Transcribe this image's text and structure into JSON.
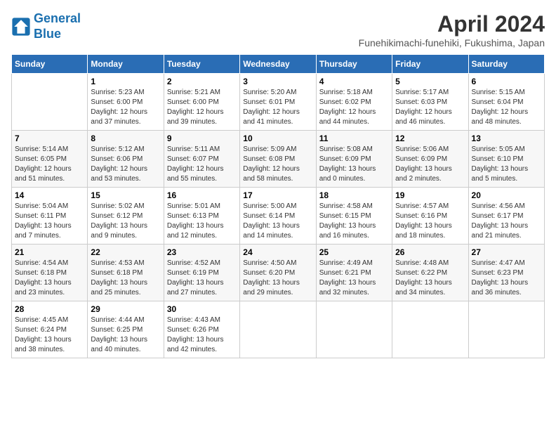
{
  "header": {
    "logo_line1": "General",
    "logo_line2": "Blue",
    "title": "April 2024",
    "subtitle": "Funehikimachi-funehiki, Fukushima, Japan"
  },
  "weekdays": [
    "Sunday",
    "Monday",
    "Tuesday",
    "Wednesday",
    "Thursday",
    "Friday",
    "Saturday"
  ],
  "weeks": [
    [
      {
        "day": "",
        "info": ""
      },
      {
        "day": "1",
        "info": "Sunrise: 5:23 AM\nSunset: 6:00 PM\nDaylight: 12 hours\nand 37 minutes."
      },
      {
        "day": "2",
        "info": "Sunrise: 5:21 AM\nSunset: 6:00 PM\nDaylight: 12 hours\nand 39 minutes."
      },
      {
        "day": "3",
        "info": "Sunrise: 5:20 AM\nSunset: 6:01 PM\nDaylight: 12 hours\nand 41 minutes."
      },
      {
        "day": "4",
        "info": "Sunrise: 5:18 AM\nSunset: 6:02 PM\nDaylight: 12 hours\nand 44 minutes."
      },
      {
        "day": "5",
        "info": "Sunrise: 5:17 AM\nSunset: 6:03 PM\nDaylight: 12 hours\nand 46 minutes."
      },
      {
        "day": "6",
        "info": "Sunrise: 5:15 AM\nSunset: 6:04 PM\nDaylight: 12 hours\nand 48 minutes."
      }
    ],
    [
      {
        "day": "7",
        "info": "Sunrise: 5:14 AM\nSunset: 6:05 PM\nDaylight: 12 hours\nand 51 minutes."
      },
      {
        "day": "8",
        "info": "Sunrise: 5:12 AM\nSunset: 6:06 PM\nDaylight: 12 hours\nand 53 minutes."
      },
      {
        "day": "9",
        "info": "Sunrise: 5:11 AM\nSunset: 6:07 PM\nDaylight: 12 hours\nand 55 minutes."
      },
      {
        "day": "10",
        "info": "Sunrise: 5:09 AM\nSunset: 6:08 PM\nDaylight: 12 hours\nand 58 minutes."
      },
      {
        "day": "11",
        "info": "Sunrise: 5:08 AM\nSunset: 6:09 PM\nDaylight: 13 hours\nand 0 minutes."
      },
      {
        "day": "12",
        "info": "Sunrise: 5:06 AM\nSunset: 6:09 PM\nDaylight: 13 hours\nand 2 minutes."
      },
      {
        "day": "13",
        "info": "Sunrise: 5:05 AM\nSunset: 6:10 PM\nDaylight: 13 hours\nand 5 minutes."
      }
    ],
    [
      {
        "day": "14",
        "info": "Sunrise: 5:04 AM\nSunset: 6:11 PM\nDaylight: 13 hours\nand 7 minutes."
      },
      {
        "day": "15",
        "info": "Sunrise: 5:02 AM\nSunset: 6:12 PM\nDaylight: 13 hours\nand 9 minutes."
      },
      {
        "day": "16",
        "info": "Sunrise: 5:01 AM\nSunset: 6:13 PM\nDaylight: 13 hours\nand 12 minutes."
      },
      {
        "day": "17",
        "info": "Sunrise: 5:00 AM\nSunset: 6:14 PM\nDaylight: 13 hours\nand 14 minutes."
      },
      {
        "day": "18",
        "info": "Sunrise: 4:58 AM\nSunset: 6:15 PM\nDaylight: 13 hours\nand 16 minutes."
      },
      {
        "day": "19",
        "info": "Sunrise: 4:57 AM\nSunset: 6:16 PM\nDaylight: 13 hours\nand 18 minutes."
      },
      {
        "day": "20",
        "info": "Sunrise: 4:56 AM\nSunset: 6:17 PM\nDaylight: 13 hours\nand 21 minutes."
      }
    ],
    [
      {
        "day": "21",
        "info": "Sunrise: 4:54 AM\nSunset: 6:18 PM\nDaylight: 13 hours\nand 23 minutes."
      },
      {
        "day": "22",
        "info": "Sunrise: 4:53 AM\nSunset: 6:18 PM\nDaylight: 13 hours\nand 25 minutes."
      },
      {
        "day": "23",
        "info": "Sunrise: 4:52 AM\nSunset: 6:19 PM\nDaylight: 13 hours\nand 27 minutes."
      },
      {
        "day": "24",
        "info": "Sunrise: 4:50 AM\nSunset: 6:20 PM\nDaylight: 13 hours\nand 29 minutes."
      },
      {
        "day": "25",
        "info": "Sunrise: 4:49 AM\nSunset: 6:21 PM\nDaylight: 13 hours\nand 32 minutes."
      },
      {
        "day": "26",
        "info": "Sunrise: 4:48 AM\nSunset: 6:22 PM\nDaylight: 13 hours\nand 34 minutes."
      },
      {
        "day": "27",
        "info": "Sunrise: 4:47 AM\nSunset: 6:23 PM\nDaylight: 13 hours\nand 36 minutes."
      }
    ],
    [
      {
        "day": "28",
        "info": "Sunrise: 4:45 AM\nSunset: 6:24 PM\nDaylight: 13 hours\nand 38 minutes."
      },
      {
        "day": "29",
        "info": "Sunrise: 4:44 AM\nSunset: 6:25 PM\nDaylight: 13 hours\nand 40 minutes."
      },
      {
        "day": "30",
        "info": "Sunrise: 4:43 AM\nSunset: 6:26 PM\nDaylight: 13 hours\nand 42 minutes."
      },
      {
        "day": "",
        "info": ""
      },
      {
        "day": "",
        "info": ""
      },
      {
        "day": "",
        "info": ""
      },
      {
        "day": "",
        "info": ""
      }
    ]
  ]
}
